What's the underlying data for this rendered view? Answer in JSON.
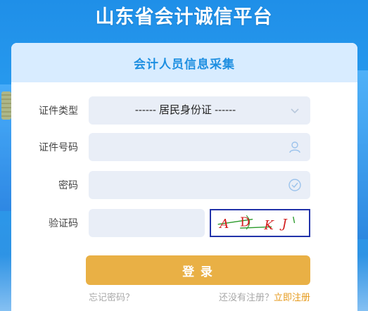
{
  "site": {
    "title": "山东省会计诚信平台"
  },
  "card": {
    "title": "会计人员信息采集"
  },
  "form": {
    "cert_type": {
      "label": "证件类型",
      "value": "------ 居民身份证 ------"
    },
    "cert_no": {
      "label": "证件号码",
      "value": ""
    },
    "password": {
      "label": "密码",
      "value": ""
    },
    "captcha": {
      "label": "验证码",
      "value": "",
      "image_text": "ADKJ"
    }
  },
  "actions": {
    "login": "登 录",
    "forgot": "忘记密码？",
    "no_account": "还没有注册？",
    "register": "立即注册"
  },
  "colors": {
    "accent": "#1e8fe1",
    "login_button": "#e9b045",
    "register_link": "#e69a1c"
  }
}
